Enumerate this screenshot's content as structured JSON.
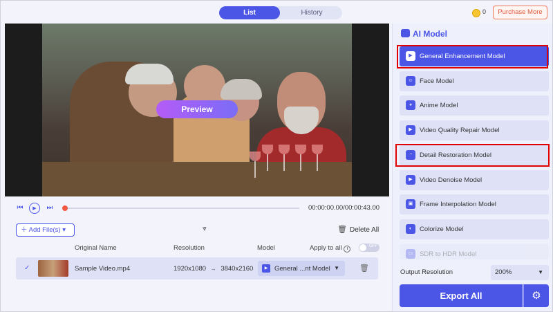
{
  "topbar": {
    "tabs": [
      {
        "label": "List"
      },
      {
        "label": "History"
      }
    ],
    "coins": "0",
    "purchase_label": "Purchase More"
  },
  "video": {
    "preview_label": "Preview"
  },
  "player": {
    "time": "00:00:00.00/00:00:43.00",
    "progress": 0
  },
  "toolbar": {
    "add_files_label": "Add File(s)",
    "delete_all_label": "Delete All"
  },
  "table": {
    "headers": {
      "original_name": "Original Name",
      "resolution": "Resolution",
      "model": "Model",
      "apply_to_all": "Apply to all",
      "toggle": "OFF"
    },
    "rows": [
      {
        "name": "Sample Video.mp4",
        "res_from": "1920x1080",
        "arrow": "→",
        "res_to": "3840x2160",
        "model": "General ...nt Model"
      }
    ]
  },
  "panel": {
    "title": "AI Model",
    "models": [
      {
        "label": "General Enhancement Model",
        "active": true,
        "highlighted": true
      },
      {
        "label": "Face Model"
      },
      {
        "label": "Anime Model"
      },
      {
        "label": "Video Quality Repair Model"
      },
      {
        "label": "Detail Restoration Model",
        "highlighted": true
      },
      {
        "label": "Video Denoise Model"
      },
      {
        "label": "Frame Interpolation Model"
      },
      {
        "label": "Colorize Model"
      },
      {
        "label": "SDR to HDR Model",
        "faded": true
      }
    ],
    "output_resolution_label": "Output Resolution",
    "output_resolution_value": "200%",
    "export_label": "Export All"
  },
  "colors": {
    "accent": "#4b55e6",
    "highlight": "#e00000",
    "purchase": "#e2573a"
  }
}
